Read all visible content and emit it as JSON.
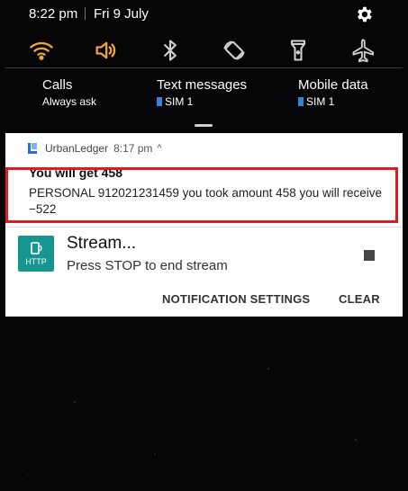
{
  "status_bar": {
    "time": "8:22 pm",
    "date": "Fri 9 July"
  },
  "quick_settings": [
    {
      "icon": "wifi-icon",
      "color": "#e9a43a"
    },
    {
      "icon": "volume-icon",
      "color": "#e9a43a"
    },
    {
      "icon": "bluetooth-icon",
      "color": "#cfcfcf"
    },
    {
      "icon": "auto-rotate-icon",
      "color": "#cfcfcf"
    },
    {
      "icon": "flashlight-icon",
      "color": "#cfcfcf"
    },
    {
      "icon": "airplane-mode-icon",
      "color": "#cfcfcf"
    }
  ],
  "sim_settings": [
    {
      "title": "Calls",
      "value": "Always ask"
    },
    {
      "title": "Text messages",
      "value": "SIM 1"
    },
    {
      "title": "Mobile data",
      "value": "SIM 1"
    }
  ],
  "notification": {
    "app": "UrbanLedger",
    "time": "8:17 pm",
    "chevron": "^",
    "title": "You will get 458",
    "body": "PERSONAL 912021231459 you took amount 458 you will receive −522"
  },
  "stream": {
    "icon_label": "HTTP",
    "title": "Stream...",
    "subtitle": "Press STOP to end stream"
  },
  "actions": {
    "settings": "NOTIFICATION SETTINGS",
    "clear": "CLEAR"
  },
  "colors": {
    "accent": "#e9a43a",
    "highlight": "#e11b22",
    "stream_icon": "#17958f"
  }
}
